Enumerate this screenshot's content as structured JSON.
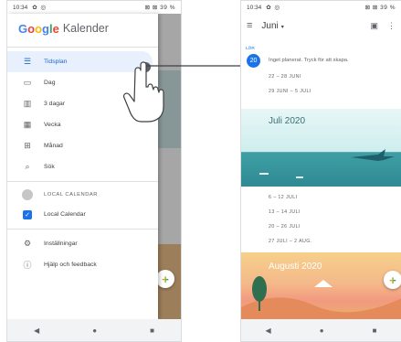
{
  "left_phone": {
    "status": {
      "time": "10:34",
      "icons": "✿ ◎",
      "right": "⊠ ⊠ 39 %"
    },
    "drawer": {
      "logo": [
        "G",
        "o",
        "o",
        "g",
        "l",
        "e"
      ],
      "app_name": "Kalender",
      "items": [
        {
          "label": "Tidsplan",
          "icon": "schedule-icon",
          "glyph": "☰",
          "active": true
        },
        {
          "label": "Dag",
          "icon": "day-icon",
          "glyph": "▭"
        },
        {
          "label": "3 dagar",
          "icon": "three-days-icon",
          "glyph": "▥"
        },
        {
          "label": "Vecka",
          "icon": "week-icon",
          "glyph": "▦"
        },
        {
          "label": "Månad",
          "icon": "month-icon",
          "glyph": "⊞"
        },
        {
          "label": "Sök",
          "icon": "search-icon",
          "glyph": "⌕"
        }
      ],
      "section_label": "LOCAL CALENDAR",
      "calendar_item": "Local Calendar",
      "settings": "Inställningar",
      "help": "Hjälp och feedback"
    },
    "navbar": {
      "back": "◀",
      "home": "●",
      "recent": "■"
    }
  },
  "right_phone": {
    "status": {
      "time": "10:34",
      "icons": "✿ ◎",
      "right": "⊠ ⊠ 39 %"
    },
    "appbar": {
      "menu": "≡",
      "month": "Juni",
      "caret": "▾",
      "today_icon": "▣",
      "more_icon": "⋮"
    },
    "today": {
      "dow": "LÖR",
      "date": "20",
      "message": "Inget planerat. Tryck för att skapa."
    },
    "weeks_top": [
      "22 – 28 JUNI",
      "29 JUNI – 5 JULI"
    ],
    "july_title": "Juli 2020",
    "weeks_july": [
      "6 – 12 JULI",
      "13 – 14 JULI",
      "20 – 26 JULI",
      "27 JULI – 2 AUG."
    ],
    "aug_title": "Augusti 2020",
    "fab": "+",
    "navbar": {
      "back": "◀",
      "home": "●",
      "recent": "■"
    }
  },
  "colors": {
    "accent": "#1a73e8",
    "active_bg": "#e8f0fe"
  }
}
